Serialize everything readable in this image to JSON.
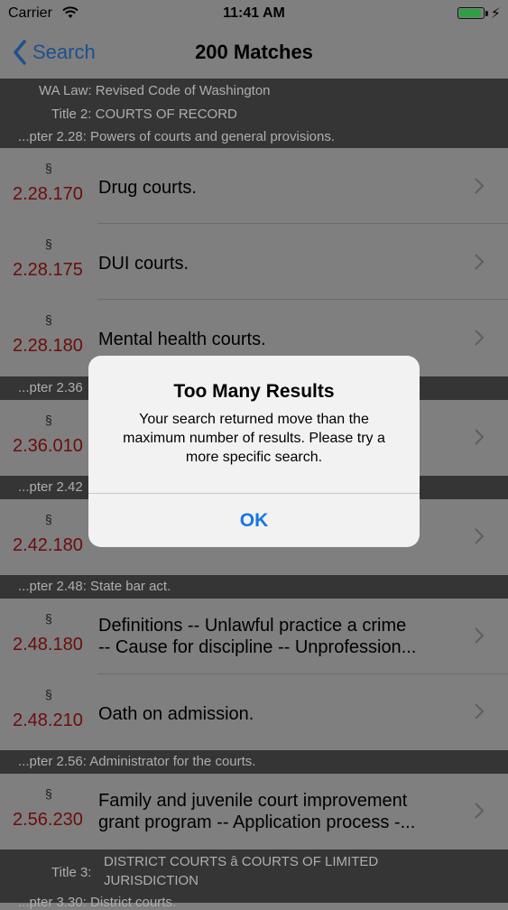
{
  "status_bar": {
    "carrier": "Carrier",
    "time": "11:41 AM",
    "battery_color": "#2ea043",
    "battery_level": 0.85
  },
  "nav": {
    "back_label": "Search",
    "title": "200 Matches"
  },
  "header_top": {
    "line1": "WA Law: Revised Code of Washington",
    "line2": "Title 2: COURTS OF RECORD",
    "line3": "...pter 2.28: Powers of courts and general provisions."
  },
  "sections": {
    "ch236": "...pter 2.36",
    "ch242": "...pter 2.42",
    "ch248": "...pter 2.48: State bar act.",
    "ch256": "...pter 2.56: Administrator for the courts.",
    "title3_label": "Title 3:",
    "title3_line1": "DISTRICT COURTS  â  COURTS OF LIMITED",
    "title3_line2": "JURISDICTION",
    "ch320": "...pter 3.30: District courts."
  },
  "symbol": "§",
  "rows": [
    {
      "num": "2.28.170",
      "title": "Drug courts."
    },
    {
      "num": "2.28.175",
      "title": "DUI courts."
    },
    {
      "num": "2.28.180",
      "title": "Mental health courts."
    },
    {
      "num": "2.36.010",
      "title": ""
    },
    {
      "num": "2.42.180",
      "title": ""
    },
    {
      "num": "2.48.180",
      "title_l1": "Definitions -- Unlawful practice a crime",
      "title_l2": "-- Cause for discipline -- Unprofession..."
    },
    {
      "num": "2.48.210",
      "title": "Oath on admission."
    },
    {
      "num": "2.56.230",
      "title_l1": "Family and juvenile court improvement",
      "title_l2": "grant program -- Application process -..."
    }
  ],
  "alert": {
    "title": "Too Many Results",
    "message": "Your search returned move than the maximum number of results. Please try a more specific search.",
    "ok_label": "OK",
    "ok_color": "#1677e6"
  }
}
